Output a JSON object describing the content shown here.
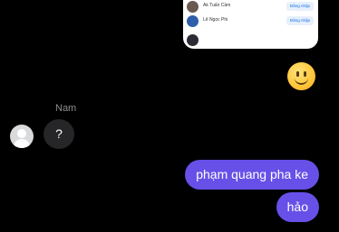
{
  "shared_card": {
    "accounts": [
      {
        "name": "Ak Tuấn Cầm",
        "button": "Đăng nhập"
      },
      {
        "name": "Lê Ngọc Phi",
        "button": "Đăng nhập"
      }
    ]
  },
  "reaction_emoji": "slightly-smiling-face",
  "incoming": {
    "sender": "Nam",
    "message": "?"
  },
  "outgoing": {
    "messages": [
      "phạm quang pha ke",
      "hảo"
    ]
  },
  "colors": {
    "outgoing_bubble": "#6750e8",
    "incoming_bubble": "#262628",
    "background": "#000000"
  }
}
